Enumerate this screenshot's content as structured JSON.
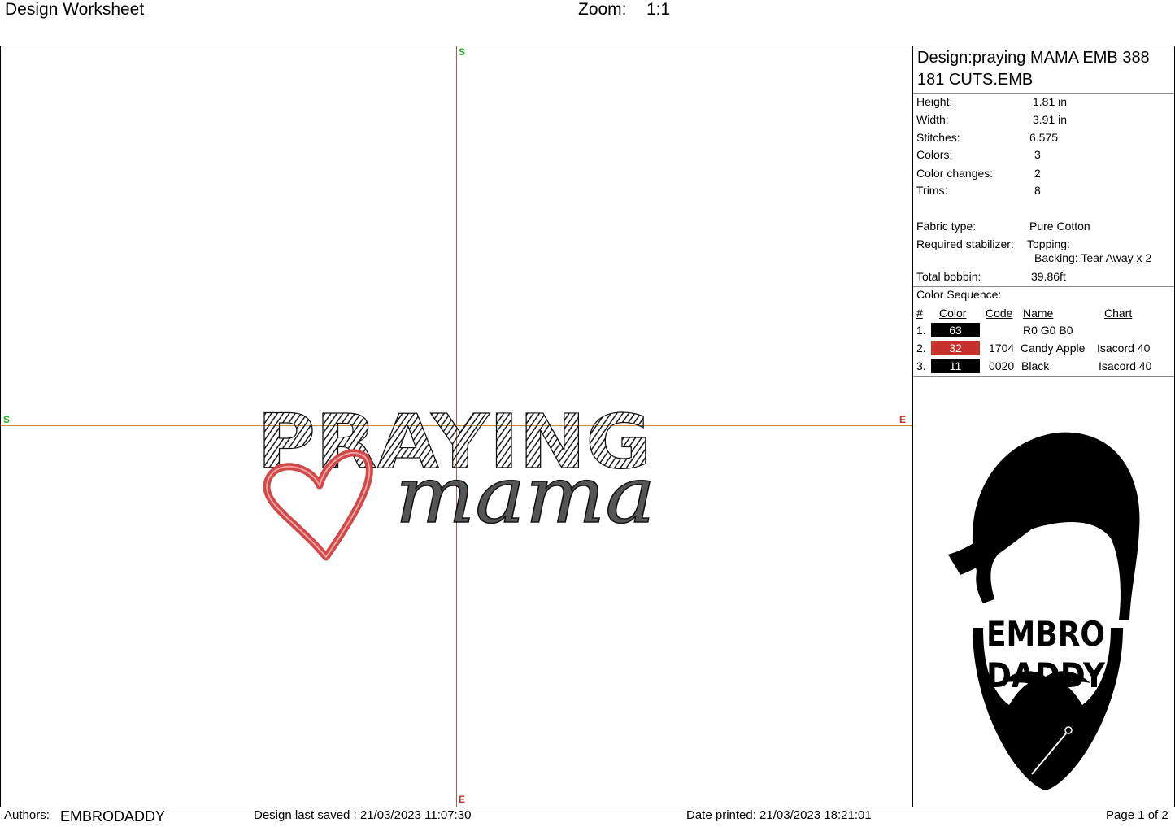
{
  "header": {
    "title": "Design Worksheet",
    "zoom_label": "Zoom:",
    "zoom_value": "1:1"
  },
  "canvas": {
    "markers": {
      "top": "S",
      "left": "S",
      "right": "E",
      "bottom": "E"
    },
    "design_text": {
      "line1": "PRAYING",
      "line2": "mama"
    },
    "colors": {
      "stitch_black": "#1a1a1a",
      "stitch_red": "#d04848",
      "axis_vertical": "#b0584a",
      "axis_horizontal": "#c28a33"
    }
  },
  "summary": {
    "design_name": "Design:praying MAMA EMB 388 181 CUTS.EMB",
    "height_label": "Height:",
    "height_value": "1.81 in",
    "width_label": "Width:",
    "width_value": "3.91 in",
    "stitches_label": "Stitches:",
    "stitches_value": "6.575",
    "colors_label": "Colors:",
    "colors_value": "3",
    "color_changes_label": "Color changes:",
    "color_changes_value": "2",
    "trims_label": "Trims:",
    "trims_value": "8",
    "fabric_label": "Fabric type:",
    "fabric_value": "Pure Cotton",
    "stabilizer_label": "Required stabilizer:",
    "topping_value": "Topping:",
    "backing_value": "Backing: Tear Away x 2",
    "bobbin_label": "Total bobbin:",
    "bobbin_value": "39.86ft"
  },
  "color_sequence": {
    "title": "Color Sequence:",
    "headers": {
      "num": "#",
      "color": "Color",
      "code": "Code",
      "name": "Name",
      "chart": "Chart"
    },
    "rows": [
      {
        "num": "1.",
        "swatch": "63",
        "swatch_color": "#000000",
        "code": "",
        "name": "R0 G0 B0",
        "chart": ""
      },
      {
        "num": "2.",
        "swatch": "32",
        "swatch_color": "#c8302c",
        "code": "1704",
        "name": "Candy Apple",
        "chart": "Isacord 40"
      },
      {
        "num": "3.",
        "swatch": "11",
        "swatch_color": "#000000",
        "code": "0020",
        "name": "Black",
        "chart": "Isacord 40"
      }
    ]
  },
  "logo": {
    "line1": "EMBRO",
    "line2": "DADDY"
  },
  "footer": {
    "authors_label": "Authors:",
    "authors_value": "EMBRODADDY",
    "saved": "Design last saved : 21/03/2023 11:07:30",
    "printed": "Date printed: 21/03/2023 18:21:01",
    "page": "Page 1 of 2"
  }
}
